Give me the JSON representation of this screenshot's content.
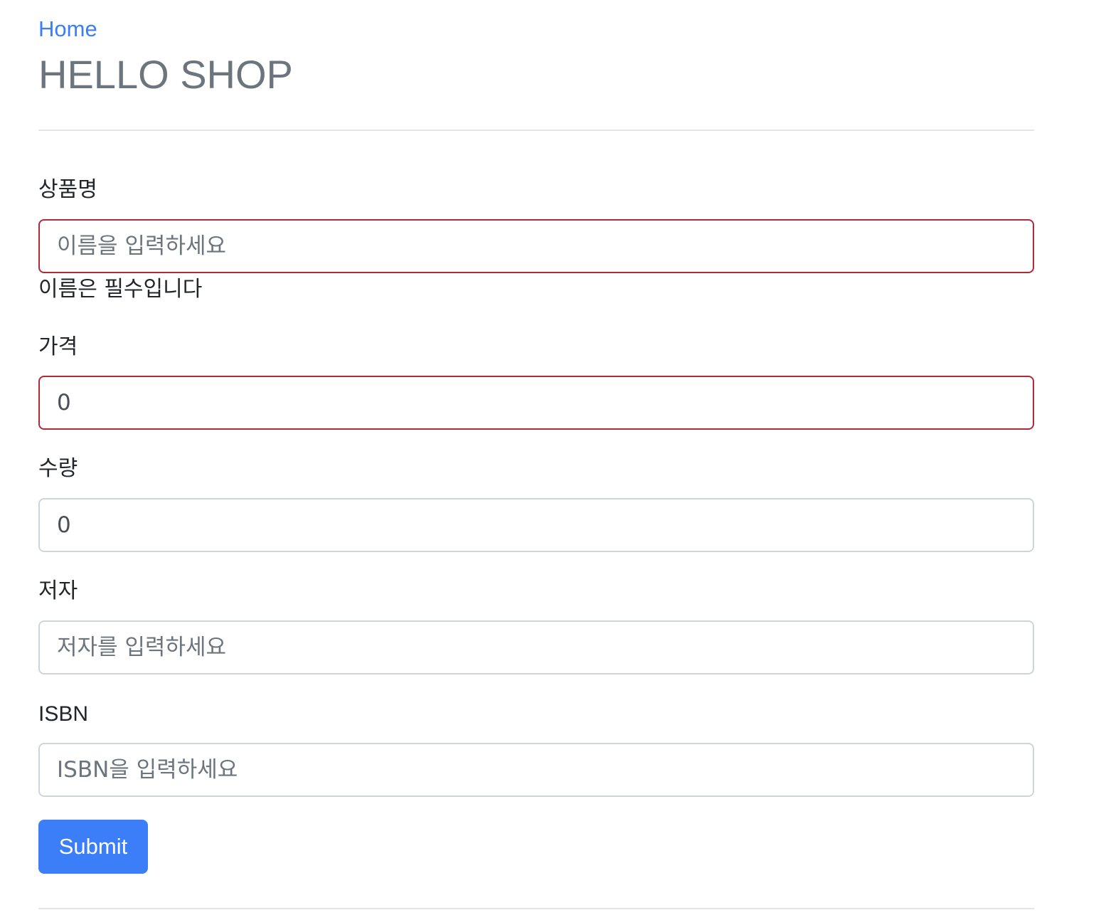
{
  "nav": {
    "home_label": "Home"
  },
  "header": {
    "title": "HELLO SHOP"
  },
  "form": {
    "name": {
      "label": "상품명",
      "value": "",
      "placeholder": "이름을 입력하세요",
      "error": "이름은 필수입니다"
    },
    "price": {
      "label": "가격",
      "value": "0",
      "placeholder": ""
    },
    "quantity": {
      "label": "수량",
      "value": "0",
      "placeholder": ""
    },
    "author": {
      "label": "저자",
      "value": "",
      "placeholder": "저자를 입력하세요"
    },
    "isbn": {
      "label": "ISBN",
      "value": "",
      "placeholder": "ISBN을 입력하세요"
    },
    "submit_label": "Submit"
  },
  "colors": {
    "link": "#3b7ef7",
    "button": "#3b7ef7",
    "invalid_border": "#b02a37",
    "title": "#6c757d"
  }
}
